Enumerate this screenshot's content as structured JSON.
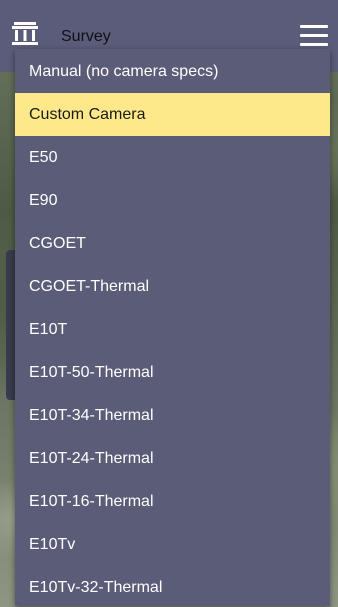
{
  "header": {
    "title": "Survey",
    "app_icon": "bank-icon",
    "menu_icon": "hamburger-menu-icon"
  },
  "dropdown": {
    "selected_index": 1,
    "options": [
      "Manual (no camera specs)",
      "Custom Camera",
      "E50",
      "E90",
      "CGOET",
      "CGOET-Thermal",
      "E10T",
      "E10T-50-Thermal",
      "E10T-34-Thermal",
      "E10T-24-Thermal",
      "E10T-16-Thermal",
      "E10Tv",
      "E10Tv-32-Thermal"
    ]
  },
  "colors": {
    "toolbar": "#5b5c79",
    "dropdown_bg": "#5b5c78",
    "selected_bg": "#fde98a",
    "option_text": "#ffffff"
  }
}
